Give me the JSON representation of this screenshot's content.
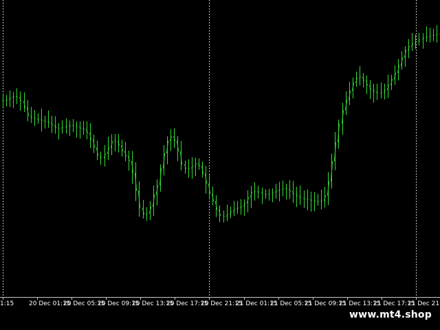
{
  "watermark": "www.mt4.shop",
  "colors": {
    "background": "#000000",
    "candle": "#33dd33",
    "grid": "#c8c8c8",
    "level_line": "#8c8c8c",
    "text": "#ffffff"
  },
  "chart_data": {
    "type": "candlestick",
    "title": "",
    "xlabel": "",
    "ylabel": "",
    "timeframe_minutes": 15,
    "grid": true,
    "horizontal_level": 103,
    "y_axis_labels_visible": false,
    "ylim": [
      0,
      100
    ],
    "x_tick_labels": [
      "1:15",
      "20 Dec 01:15",
      "20 Dec 05:15",
      "20 Dec 09:15",
      "20 Dec 13:15",
      "20 Dec 17:15",
      "20 Dec 21:15",
      "21 Dec 01:15",
      "21 Dec 05:15",
      "21 Dec 09:15",
      "21 Dec 13:15",
      "21 Dec 17:15",
      "21 Dec 21:15",
      "22 De"
    ],
    "vertical_gridlines_at_ticks": [
      0,
      6,
      12
    ],
    "series": [
      {
        "values": [
          67.8,
          68.2,
          68.8,
          69.2,
          68.9,
          67.7,
          65.6,
          63.0,
          62.3,
          62.1,
          61.8,
          61.5,
          61.2,
          60.8,
          60.0,
          59.1,
          59.0,
          59.3,
          59.6,
          59.9,
          59.8,
          59.4,
          59.0,
          58.6,
          57.6,
          55.4,
          52.8,
          50.2,
          49.5,
          50.8,
          52.8,
          54.8,
          54.9,
          53.5,
          51.7,
          50.0,
          48.5,
          44.7,
          39.0,
          33.5,
          31.4,
          31.8,
          33.9,
          37.8,
          40.8,
          46.2,
          51.0,
          55.0,
          56.4,
          55.0,
          51.6,
          47.4,
          46.0,
          46.2,
          46.9,
          47.8,
          47.0,
          44.5,
          41.3,
          38.0,
          35.7,
          33.0,
          31.0,
          30.8,
          31.5,
          32.4,
          33.1,
          33.6,
          34.0,
          35.1,
          36.9,
          38.6,
          38.8,
          38.6,
          38.1,
          37.8,
          38.0,
          38.5,
          39.0,
          39.4,
          39.8,
          39.6,
          38.8,
          38.0,
          37.3,
          36.7,
          36.4,
          36.2,
          35.9,
          35.7,
          35.6,
          35.8,
          37.5,
          42.0,
          48.5,
          54.5,
          60.5,
          64.8,
          68.0,
          71.0,
          73.5,
          75.1,
          75.4,
          74.2,
          72.7,
          71.3,
          70.6,
          70.2,
          70.4,
          71.2,
          72.8,
          74.7,
          76.7,
          79.0,
          81.6,
          83.9,
          85.2,
          86.1,
          86.8,
          87.4,
          87.9,
          88.3,
          88.6,
          88.8,
          89.0,
          89.4
        ]
      }
    ]
  }
}
